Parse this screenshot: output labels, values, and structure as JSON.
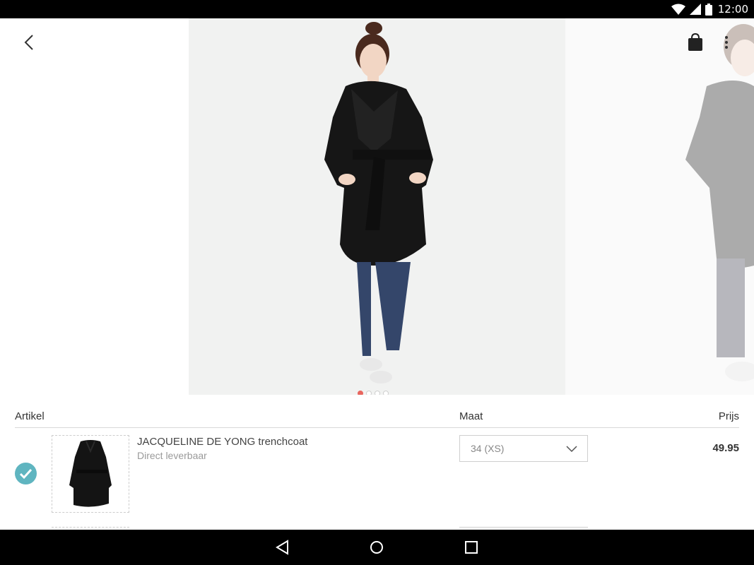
{
  "status_bar": {
    "time": "12:00",
    "icons": [
      "wifi-icon",
      "cell-signal-icon",
      "battery-icon"
    ]
  },
  "gallery": {
    "images": [
      "coat-model-front-photo",
      "coat-model-side-photo"
    ],
    "page_count": 4,
    "active_page": 1,
    "accent_color": "#e8665f"
  },
  "toolbar": {
    "back_icon": "chevron-left-icon",
    "bag_icon": "shopping-bag-icon",
    "more_icon": "more-vertical-icon"
  },
  "table": {
    "headers": {
      "artikel": "Artikel",
      "maat": "Maat",
      "prijs": "Prijs"
    },
    "rows": [
      {
        "selected": true,
        "name": "JACQUELINE DE YONG trenchcoat",
        "availability": "Direct leverbaar",
        "size": "34 (XS)",
        "price": "49.95"
      }
    ],
    "check_color": "#5fb5c0"
  },
  "nav_bar": {
    "icons": [
      "back-triangle-icon",
      "home-circle-icon",
      "recents-square-icon"
    ]
  }
}
